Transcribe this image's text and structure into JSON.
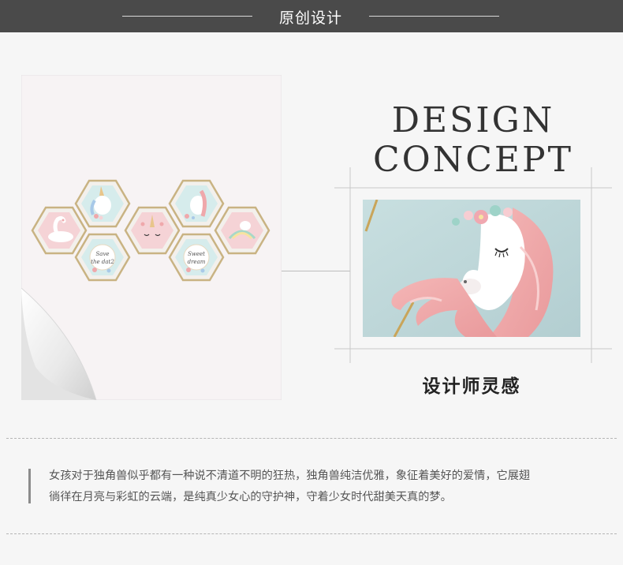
{
  "header": {
    "title": "原创设计"
  },
  "concept": {
    "line1": "DESIGN",
    "line2": "CONCEPT"
  },
  "subtitle": "设计师灵感",
  "description": {
    "line1": "女孩对于独角兽似乎都有一种说不清道不明的狂热，独角兽纯洁优雅，象征着美好的爱情，它展翅",
    "line2": "徜徉在月亮与彩虹的云端，是纯真少女心的守护神，守着少女时代甜美天真的梦。"
  },
  "artwork": {
    "hex_texts": {
      "save": "Save",
      "the_date": "the dat2",
      "sweet": "Sweet",
      "dream": "dream"
    }
  },
  "colors": {
    "header_bg": "#4a4a4a",
    "page_bg": "#f6f6f6",
    "hex_gold": "#c9b383",
    "hex_pink": "#f5d3d6",
    "hex_mint": "#d6ecec",
    "unicorn_pink": "#efa8ab",
    "photo_bg": "#bfd8da"
  }
}
